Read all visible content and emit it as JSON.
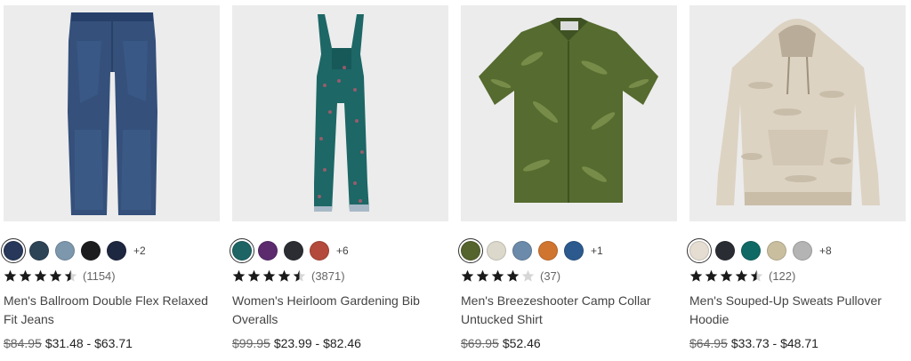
{
  "products": [
    {
      "name": "Men's Ballroom Double Flex Relaxed Fit Jeans",
      "image": "jeans-image",
      "swatches": [
        "#27385a",
        "#2d4456",
        "#7d97ad",
        "#1c1c1e",
        "#1e2740"
      ],
      "more": "+2",
      "rating": 4.5,
      "reviews": "(1154)",
      "was_price": "$84.95",
      "price": "$31.48 - $63.71"
    },
    {
      "name": "Women's Heirloom Gardening Bib Overalls",
      "image": "overalls-image",
      "swatches": [
        "#1e6464",
        "#5b2b6e",
        "#2b2d33",
        "#b34a3b"
      ],
      "more": "+6",
      "rating": 4.5,
      "reviews": "(3871)",
      "was_price": "$99.95",
      "price": "$23.99 - $82.46"
    },
    {
      "name": "Men's Breezeshooter Camp Collar Untucked Shirt",
      "image": "camp-shirt-image",
      "swatches": [
        "#55632c",
        "#dcd9cc",
        "#6c8aaa",
        "#d0752f",
        "#2c5a8e"
      ],
      "more": "+1",
      "rating": 4,
      "reviews": "(37)",
      "was_price": "$69.95",
      "price": "$52.46"
    },
    {
      "name": "Men's Souped-Up Sweats Pullover Hoodie",
      "image": "hoodie-image",
      "swatches": [
        "#e5ddd1",
        "#2a2c34",
        "#0f6a66",
        "#c9bf9f",
        "#b4b4b4"
      ],
      "more": "+8",
      "rating": 4.5,
      "reviews": "(122)",
      "was_price": "$64.95",
      "price": "$33.73 - $48.71"
    }
  ]
}
